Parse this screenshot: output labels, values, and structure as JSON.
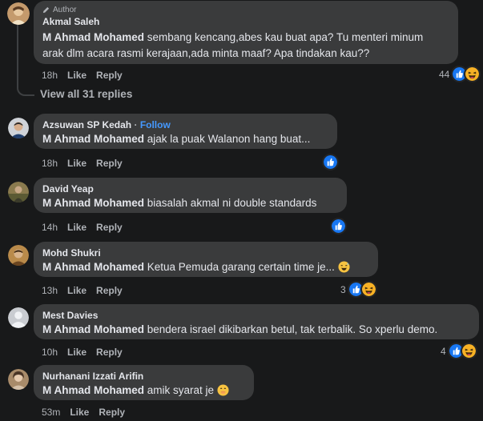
{
  "comments": [
    {
      "name": "Akmal Saleh",
      "badge": "Author",
      "mention": "M Ahmad Mohamed",
      "text_line1": " sembang kencang,abes kau buat apa? Tu menteri minum",
      "text_line2": "arak dlm acara rasmi kerajaan,ada minta maaf? Apa tindakan kau??",
      "time": "18h",
      "like": "Like",
      "reply": "Reply",
      "reaction_count": "44"
    },
    {
      "name": "Azsuwan SP Kedah",
      "follow_sep": " · ",
      "follow": "Follow",
      "mention": "M Ahmad Mohamed",
      "text": " ajak la puak Walanon hang buat...",
      "time": "18h",
      "like": "Like",
      "reply": "Reply"
    },
    {
      "name": "David Yeap",
      "mention": "M Ahmad Mohamed",
      "text": " biasalah akmal ni double standards",
      "time": "14h",
      "like": "Like",
      "reply": "Reply"
    },
    {
      "name": "Mohd Shukri",
      "mention": "M Ahmad Mohamed",
      "text": " Ketua Pemuda garang certain time je...",
      "time": "13h",
      "like": "Like",
      "reply": "Reply",
      "reaction_count": "3"
    },
    {
      "name": "Mest Davies",
      "mention": "M Ahmad Mohamed",
      "text": " bendera israel dikibarkan betul, tak terbalik. So xperlu demo.",
      "time": "10h",
      "like": "Like",
      "reply": "Reply",
      "reaction_count": "4"
    },
    {
      "name": "Nurhanani Izzati Arifin",
      "mention": "M Ahmad Mohamed",
      "text": " amik syarat je ",
      "time": "53m",
      "like": "Like",
      "reply": "Reply"
    }
  ],
  "view_replies": "View all 31 replies",
  "colors": {
    "background": "#18191a",
    "bubble": "#3a3b3c",
    "like_blue": "#1877f2",
    "follow_blue": "#4599ff",
    "meta_gray": "#b0b3b8"
  },
  "icons": {
    "like_reaction": "thumbs-up-icon",
    "haha_reaction": "laughing-face-icon",
    "author_badge": "pencil-icon"
  }
}
